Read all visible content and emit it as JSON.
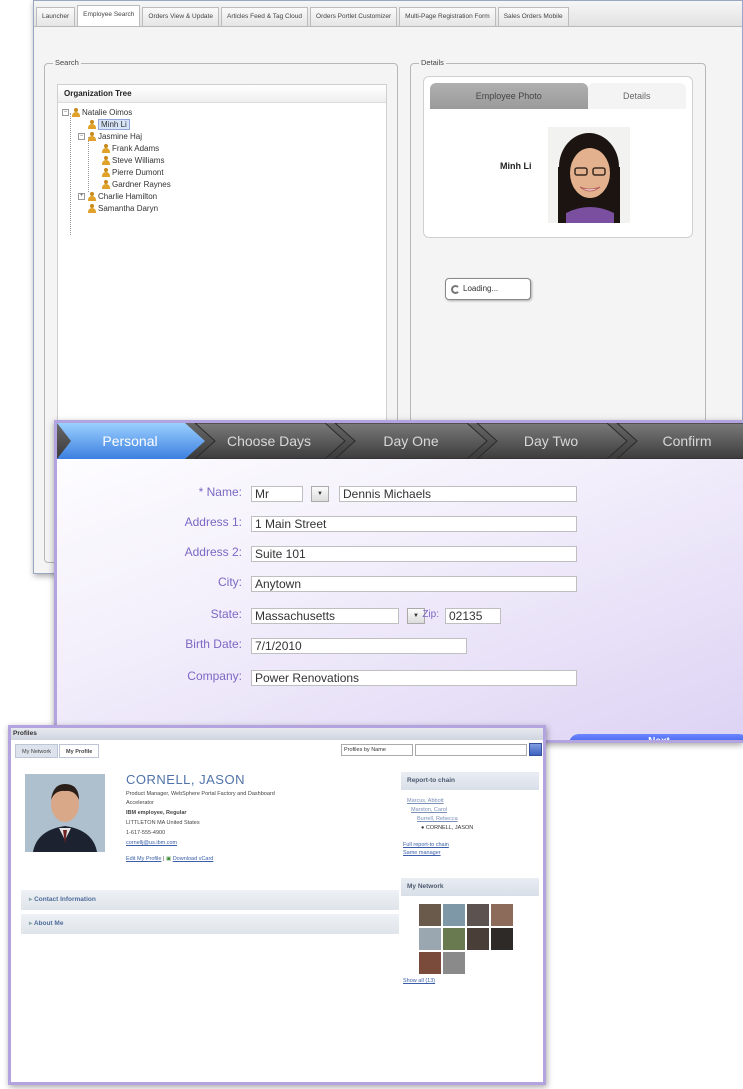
{
  "window1": {
    "tabs": [
      "Launcher",
      "Employee Search",
      "Orders View & Update",
      "Articles Feed & Tag Cloud",
      "Orders Portlet Customizer",
      "Multi-Page Registration Form",
      "Sales Orders Mobile"
    ],
    "active_tab_index": 1,
    "search_legend": "Search",
    "tree_header": "Organization Tree",
    "tree": [
      {
        "label": "Natalie Oimos",
        "level": 0,
        "expand": "⊟"
      },
      {
        "label": "Minh Li",
        "level": 1,
        "selected": true
      },
      {
        "label": "Jasmine Haj",
        "level": 1,
        "expand": "⊟"
      },
      {
        "label": "Frank Adams",
        "level": 2
      },
      {
        "label": "Steve Williams",
        "level": 2
      },
      {
        "label": "Pierre Dumont",
        "level": 2
      },
      {
        "label": "Gardner Raynes",
        "level": 2
      },
      {
        "label": "Charlie Hamilton",
        "level": 1,
        "expand": "⊞"
      },
      {
        "label": "Samantha Daryn",
        "level": 1
      }
    ],
    "details_legend": "Details",
    "detail_tabs": [
      "Employee Photo",
      "Details"
    ],
    "photo_name": "Minh Li",
    "loading_text": "Loading..."
  },
  "window2": {
    "steps": [
      "Personal",
      "Choose Days",
      "Day One",
      "Day Two",
      "Confirm"
    ],
    "form": {
      "name_label": "* Name:",
      "title_value": "Mr",
      "name_value": "Dennis Michaels",
      "address1_label": "Address 1:",
      "address1_value": "1 Main Street",
      "address2_label": "Address 2:",
      "address2_value": "Suite 101",
      "city_label": "City:",
      "city_value": "Anytown",
      "state_label": "State:",
      "state_value": "Massachusetts",
      "zip_label": "Zip:",
      "zip_value": "02135",
      "birth_label": "Birth Date:",
      "birth_value": "7/1/2010",
      "company_label": "Company:",
      "company_value": "Power Renovations"
    },
    "next_label": "Next"
  },
  "window3": {
    "title": "Profiles",
    "tabs": [
      "My Network",
      "My Profile"
    ],
    "search_select": "Profiles by Name",
    "name": "CORNELL, JASON",
    "role": "Product Manager, WebSphere Portal Factory and Dashboard",
    "role2": "Accelerator",
    "company": "IBM employee, Regular",
    "location": "LITTLETON MA United States",
    "phone": "1-617-555-4900",
    "email": "cornellj@us.ibm.com",
    "edit_link": "Edit My Profile",
    "vcard_link": "Download vCard",
    "sections": [
      "Contact Information",
      "About Me"
    ],
    "report_chain_title": "Report-to chain",
    "chain": [
      "Marcus, Abbott",
      "Marston, Carol",
      "Burrell, Rebecca",
      "CORNELL, JASON"
    ],
    "chain_links": [
      "Full report-to chain",
      "Same manager"
    ],
    "network_title": "My Network",
    "show_all": "Show all (13)"
  }
}
